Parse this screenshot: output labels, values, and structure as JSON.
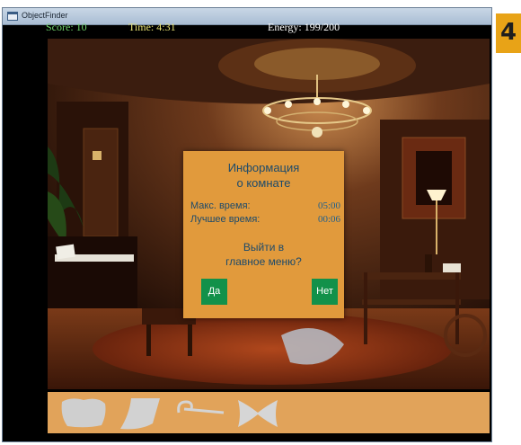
{
  "window": {
    "title": "ObjectFinder",
    "icon": "app-window-icon"
  },
  "hud": {
    "score": "Score: 10",
    "time": "Time: 4:31",
    "energy": "Energy: 199/200",
    "colors": {
      "score": "#6fd36a",
      "time": "#e6e070",
      "energy": "#ffffff"
    }
  },
  "scene": {
    "description_icon": "victorian-room-scene"
  },
  "dialog": {
    "title_line1": "Информация",
    "title_line2": "о комнате",
    "max_time_label": "Макс. время:",
    "max_time_value": "05:00",
    "best_time_label": "Лучшее время:",
    "best_time_value": "00:06",
    "question_line1": "Выйти в",
    "question_line2": "главное меню?",
    "yes_label": "Да",
    "no_label": "Нет",
    "colors": {
      "panel": "#e19a3c",
      "button": "#12914a",
      "text": "#1c4a6b"
    }
  },
  "inventory": {
    "items": [
      "cloth-item-icon",
      "paper-item-icon",
      "cane-item-icon",
      "bow-item-icon"
    ]
  },
  "badge": {
    "label": "4",
    "color": "#e8a317"
  }
}
